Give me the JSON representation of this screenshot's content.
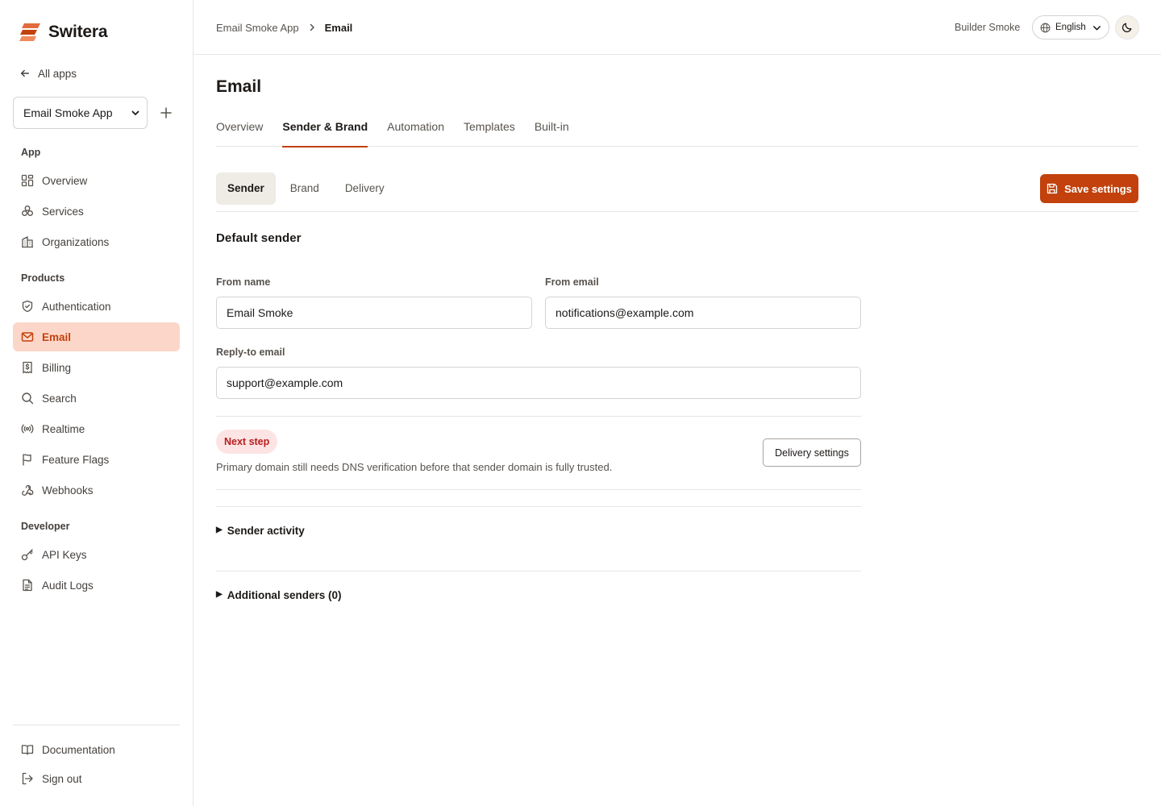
{
  "brand": {
    "name": "Switera",
    "accent": "#c2410c"
  },
  "sidebar": {
    "back_label": "All apps",
    "app_select_value": "Email Smoke App",
    "sections": [
      {
        "label": "App",
        "items": [
          {
            "label": "Overview",
            "icon": "grid-icon"
          },
          {
            "label": "Services",
            "icon": "services-icon"
          },
          {
            "label": "Organizations",
            "icon": "building-icon"
          }
        ]
      },
      {
        "label": "Products",
        "items": [
          {
            "label": "Authentication",
            "icon": "shield-icon"
          },
          {
            "label": "Email",
            "icon": "mail-icon",
            "active": true
          },
          {
            "label": "Billing",
            "icon": "receipt-icon"
          },
          {
            "label": "Search",
            "icon": "search-icon"
          },
          {
            "label": "Realtime",
            "icon": "broadcast-icon"
          },
          {
            "label": "Feature Flags",
            "icon": "flag-icon"
          },
          {
            "label": "Webhooks",
            "icon": "webhook-icon"
          }
        ]
      },
      {
        "label": "Developer",
        "items": [
          {
            "label": "API Keys",
            "icon": "key-icon"
          },
          {
            "label": "Audit Logs",
            "icon": "file-icon"
          }
        ]
      }
    ],
    "footer": [
      {
        "label": "Documentation",
        "icon": "book-icon"
      },
      {
        "label": "Sign out",
        "icon": "logout-icon"
      }
    ]
  },
  "header": {
    "breadcrumb": [
      "Email Smoke App",
      "Email"
    ],
    "user": "Builder Smoke",
    "language": "English"
  },
  "main": {
    "title": "Email",
    "tabs": [
      "Overview",
      "Sender & Brand",
      "Automation",
      "Templates",
      "Built-in"
    ],
    "active_tab": "Sender & Brand",
    "subtabs": [
      "Sender",
      "Brand",
      "Delivery"
    ],
    "active_subtab": "Sender",
    "save_label": "Save settings",
    "section_title": "Default sender",
    "fields": {
      "from_name": {
        "label": "From name",
        "value": "Email Smoke"
      },
      "from_email": {
        "label": "From email",
        "value": "notifications@example.com"
      },
      "reply_to": {
        "label": "Reply-to email",
        "value": "support@example.com"
      }
    },
    "notice": {
      "badge": "Next step",
      "text": "Primary domain still needs DNS verification before that sender domain is fully trusted.",
      "button": "Delivery settings"
    },
    "disclosures": [
      "Sender activity",
      "Additional senders (0)"
    ]
  }
}
